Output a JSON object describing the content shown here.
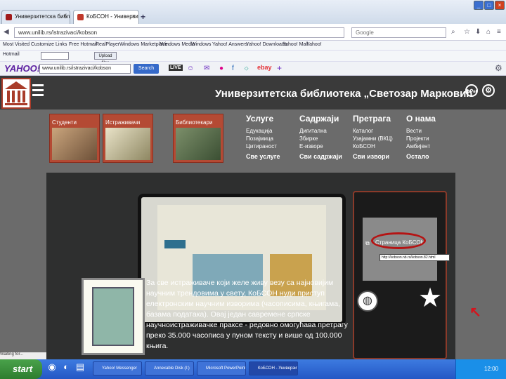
{
  "browser": {
    "tabs": [
      {
        "label": "Универзитетска библиоте..."
      },
      {
        "label": "КоБСОН - Универзитетска б..."
      }
    ],
    "new_tab": "+",
    "url": "www.unilib.rs/istrazivaci/kobson",
    "search_placeholder": "Google",
    "bookmarks": [
      "Most Visited",
      "Customize Links",
      "Free Hotmail",
      "RealPlayer",
      "Windows Marketplace",
      "Windows Media",
      "Windows",
      "Yahoo! Answers",
      "Yahoo! Downloads",
      "Yahoo! Mail",
      "Yahoo!"
    ],
    "addon_field": "Hotmail",
    "addon_button": "Upload files"
  },
  "yahoo": {
    "logo": "YAHOO!",
    "search_value": "www.unilib.rs/istrazivaci/kobson",
    "search_button": "Search",
    "live": "LIVE",
    "ebay": "ebay"
  },
  "site": {
    "title": "Универзитетска библиотека „Светозар Марковић“",
    "tiles": [
      "Студенти",
      "Истраживачи",
      "Библиотекари"
    ],
    "menus": [
      {
        "heading": "Услуге",
        "items": [
          "Едукација",
          "Позајмица",
          "Цитираност"
        ],
        "footer": "Све услуге"
      },
      {
        "heading": "Садржаји",
        "items": [
          "Дигитална",
          "Збирке",
          "Е-изворе"
        ],
        "footer": "Сви садржаји"
      },
      {
        "heading": "Претрага",
        "items": [
          "Каталог",
          "Узајамни (ВКЦ)",
          "КоБСОН"
        ],
        "footer": "Сви извори"
      },
      {
        "heading": "О нама",
        "items": [
          "Вести",
          "Пројекти",
          "Амбијент"
        ],
        "footer": "Остало"
      }
    ]
  },
  "hero": {
    "text": "За све истраживаче који желе живу везу са најновијим\nнаучним трендовима у свету, КоБСОН нуди приступ\nелектронским научним изворима (часописима, књигама,\nбазама података). Овај један савремене српске\nнаучноистраживачке праксе - редовно омогућава претрагу\nпреко 35.000 часописа у пуном тексту и више од 100.000\nкњига.",
    "link": "Страница КоБСОН",
    "tooltip": "http://kobson.nb.rs/kobson.82.html"
  },
  "status": "Waiting for...",
  "taskbar": {
    "start": "start",
    "tasks": [
      "Yahoo! Messenger",
      "Annexable Disk (I:)",
      "Microsoft PowerPoint...",
      "КоБСОН - Универзитет..."
    ],
    "clock": "12:00"
  },
  "colors": {
    "accent": "#b44a34",
    "header": "#3a3a3a",
    "ring": "#b51414"
  }
}
